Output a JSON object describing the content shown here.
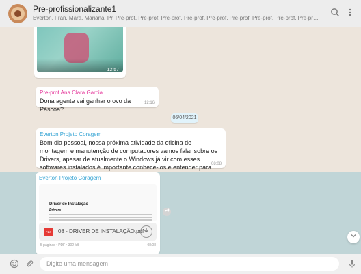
{
  "header": {
    "title": "Pre-profissionalizante1",
    "members": "Everton, Fran, Mara, Mariana, Pr. Pre-prof, Pre-prof, Pre-prof, Pre-prof, Pre-prof, Pre-prof, Pre-prof, Pre-prof, Pre-prof, Pre-prof, Pre-prof, Pre-prof, Pre-prof...",
    "icons": [
      "search-icon",
      "menu-icon"
    ]
  },
  "messages": {
    "image_message": {
      "time": "12:57"
    },
    "msg1": {
      "sender": "Pre-prof Ana Clara Garcia",
      "sender_color": "#e5359a",
      "text": "Dona agente vai ganhar o ovo da Páscoa?",
      "time": "12:16"
    },
    "date_divider": "06/04/2021",
    "msg2": {
      "sender": "Everton Projeto Coragem",
      "sender_color": "#35a4d4",
      "text": "Bom dia pessoal, nossa próxima atividade da oficina de montagem e manutenção de computadores vamos falar sobre os Drivers, apesar de atualmente o Windows já vir com esses softwares instalados é importante conhece-los e entender para que servem.",
      "time": "08:08"
    },
    "msg3": {
      "sender": "Everton Projeto Coragem",
      "sender_color": "#35a4d4",
      "doc_title": "Driver de Instalação",
      "doc_subtitle": "Drivers",
      "file_name": "08 - DRIVER DE INSTALAÇÃO.pdf",
      "file_meta": "5 páginas • PDF • 302 kB",
      "time": "08:08",
      "pdf_label": "PDF"
    }
  },
  "footer": {
    "placeholder": "Digite uma mensagem",
    "icons": [
      "emoji-icon",
      "attach-icon",
      "mic-icon"
    ]
  },
  "colors": {
    "background": "#ede5dc",
    "header_bg": "#ededed",
    "selected_band": "#9bc8d4",
    "date_chip_bg": "#e1f3fb"
  }
}
